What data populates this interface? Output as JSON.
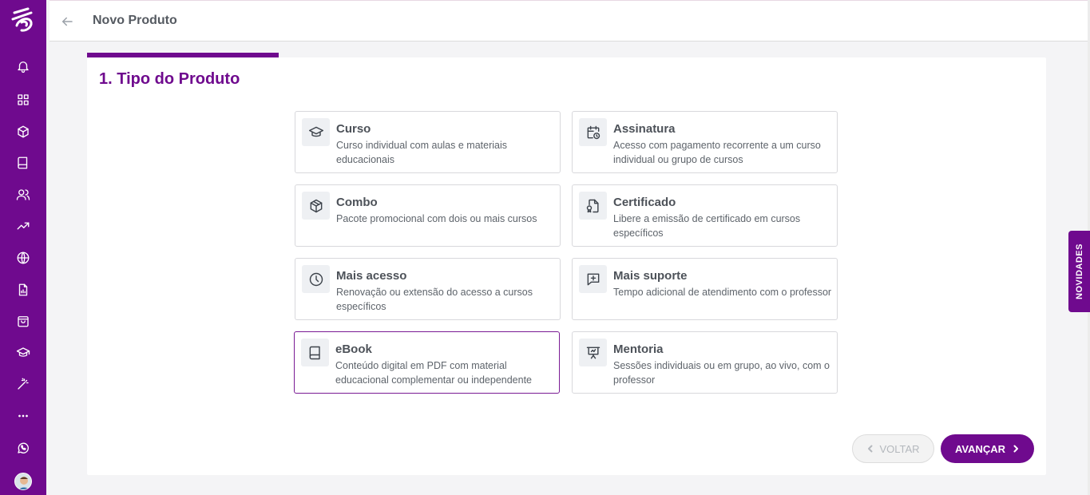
{
  "header": {
    "title": "Novo Produto"
  },
  "sidebar": {
    "items": [
      {
        "icon": "bell-icon"
      },
      {
        "icon": "dashboard-grid-icon"
      },
      {
        "icon": "cube-icon"
      },
      {
        "icon": "book-icon"
      },
      {
        "icon": "users-icon"
      },
      {
        "icon": "trending-up-icon"
      },
      {
        "icon": "globe-icon"
      },
      {
        "icon": "report-icon"
      },
      {
        "icon": "shopping-bag-icon"
      },
      {
        "icon": "graduation-cap-icon"
      },
      {
        "icon": "magic-wand-icon"
      },
      {
        "icon": "more-dots-icon"
      },
      {
        "icon": "whatsapp-icon"
      }
    ]
  },
  "step": {
    "title": "1. Tipo do Produto"
  },
  "options": [
    {
      "name": "Curso",
      "desc": "Curso individual com aulas e materiais educacionais",
      "icon": "graduation-cap-icon"
    },
    {
      "name": "Assinatura",
      "desc": "Acesso com pagamento recorrente a um curso individual ou grupo de cursos",
      "icon": "calendar-clock-icon"
    },
    {
      "name": "Combo",
      "desc": "Pacote promocional com dois ou mais cursos",
      "icon": "package-icon"
    },
    {
      "name": "Certificado",
      "desc": "Libere a emissão de certificado em cursos específicos",
      "icon": "certificate-icon"
    },
    {
      "name": "Mais acesso",
      "desc": "Renovação ou extensão do acesso a cursos específicos",
      "icon": "clock-icon"
    },
    {
      "name": "Mais suporte",
      "desc": "Tempo adicional de atendimento com o professor",
      "icon": "message-plus-icon"
    },
    {
      "name": "eBook",
      "desc": "Conteúdo digital em PDF com material educacional complementar ou independente",
      "icon": "book-icon"
    },
    {
      "name": "Mentoria",
      "desc": "Sessões individuais ou em grupo, ao vivo, com o professor",
      "icon": "presentation-icon"
    }
  ],
  "selected_option": "eBook",
  "buttons": {
    "back": "VOLTAR",
    "next": "AVANÇAR"
  },
  "novidades": "NOVIDADES",
  "colors": {
    "brand": "#6f0a8e"
  }
}
